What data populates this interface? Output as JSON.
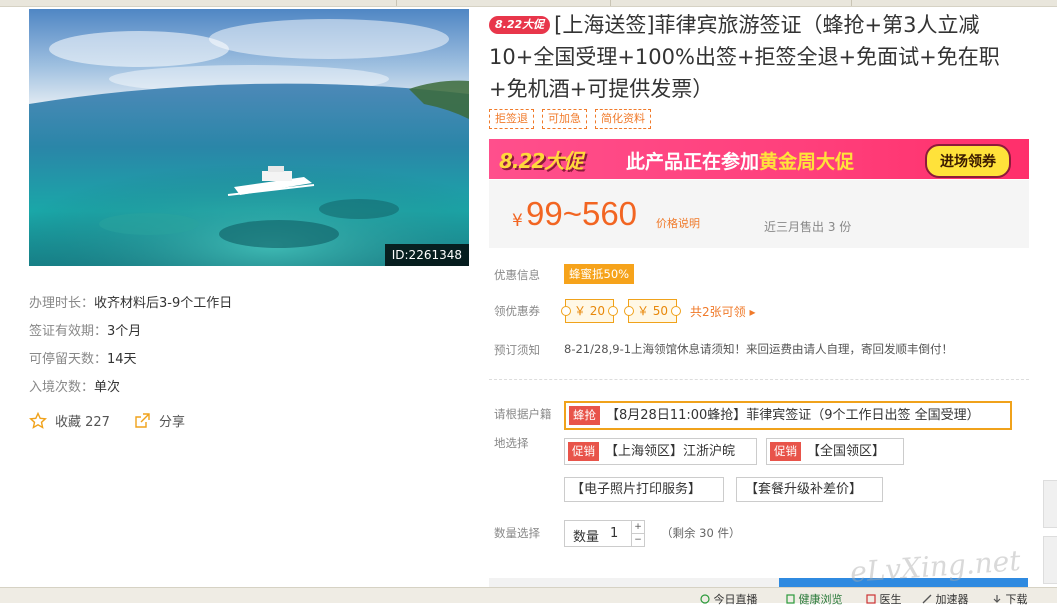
{
  "product": {
    "photo_id": "ID:2261348",
    "title_badge": "8.22大促",
    "title": "[上海送签]菲律宾旅游签证（蜂抢+第3人立减10+全国受理+100%出签+拒签全退+免面试+免在职+免机酒+可提供发票）",
    "tags": [
      "拒签退",
      "可加急",
      "简化资料"
    ]
  },
  "info": [
    {
      "label": "办理时长：",
      "value": "收齐材料后3-9个工作日"
    },
    {
      "label": "签证有效期：",
      "value": "3个月"
    },
    {
      "label": "可停留天数：",
      "value": "14天"
    },
    {
      "label": "入境次数：",
      "value": "单次"
    }
  ],
  "actions": {
    "favorite_label": "收藏 227",
    "share_label": "分享"
  },
  "banner": {
    "logo": "8.22大促",
    "text_prefix": "此产品正在参加",
    "text_highlight": "黄金周大促",
    "button": "进场领券"
  },
  "price": {
    "currency": "¥",
    "range": "99~560",
    "note": "价格说明",
    "sold": "近三月售出 3 份"
  },
  "promo": {
    "discount_label": "优惠信息",
    "discount_badge": "蜂蜜抵50%",
    "coupon_label": "领优惠券",
    "coupons": [
      "￥ 20",
      "￥ 50"
    ],
    "coupon_more": "共2张可领 ▸",
    "notice_label": "预订须知",
    "notice_text": "8-21/28,9-1上海领馆休息请须知！来回运费由请人自理，寄回发顺丰倒付！"
  },
  "options": {
    "label_line1": "请根据户籍",
    "label_line2": "地选择",
    "items": [
      {
        "tag": "蜂抢",
        "text": "【8月28日11:00蜂抢】菲律宾签证（9个工作日出签 全国受理）"
      },
      {
        "tag": "促销",
        "text": "【上海领区】江浙沪皖"
      },
      {
        "tag": "促销",
        "text": "【全国领区】"
      },
      {
        "tag": "",
        "text": "【电子照片打印服务】"
      },
      {
        "tag": "",
        "text": "【套餐升级补差价】"
      }
    ]
  },
  "quantity": {
    "label": "数量选择",
    "field_label": "数量",
    "value": "1",
    "plus": "+",
    "minus": "−",
    "remaining": "（剩余 30 件）"
  },
  "statusbar": {
    "items": [
      "今日直播",
      "健康浏览",
      "医生",
      "加速器",
      "下载"
    ]
  },
  "watermark": "eLvXing.net"
}
